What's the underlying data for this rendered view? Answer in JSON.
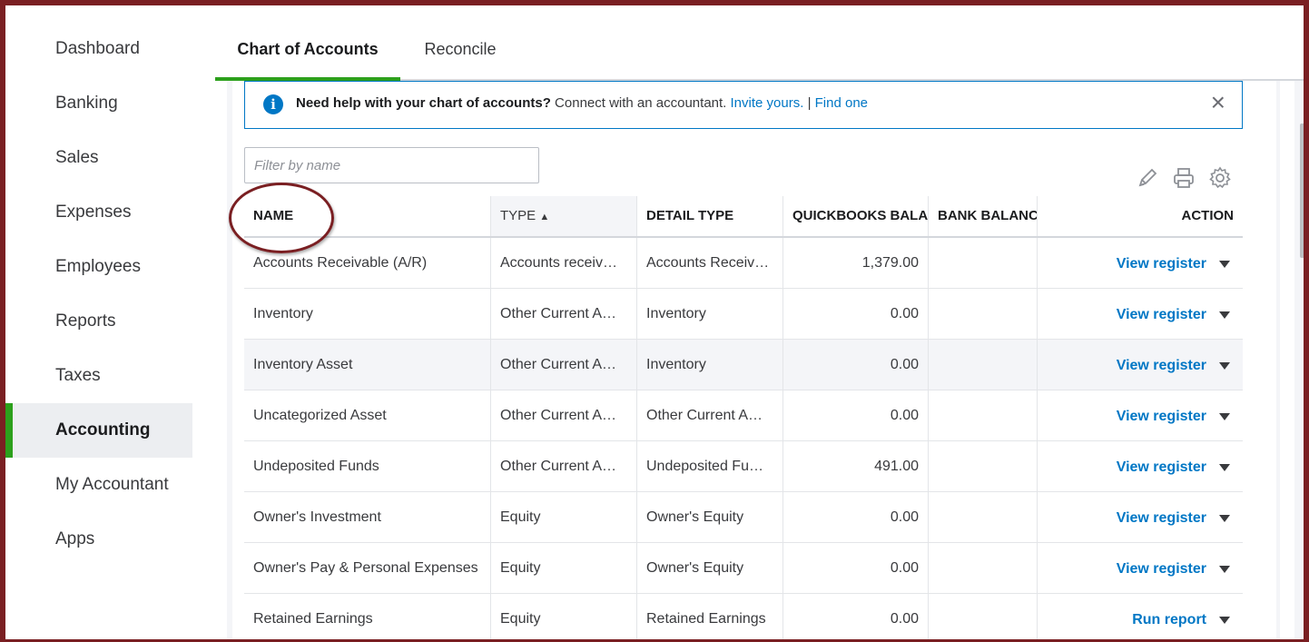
{
  "sidebar": {
    "items": [
      {
        "label": "Dashboard"
      },
      {
        "label": "Banking"
      },
      {
        "label": "Sales"
      },
      {
        "label": "Expenses"
      },
      {
        "label": "Employees"
      },
      {
        "label": "Reports"
      },
      {
        "label": "Taxes"
      },
      {
        "label": "Accounting"
      },
      {
        "label": "My Accountant"
      },
      {
        "label": "Apps"
      }
    ],
    "active": "Accounting"
  },
  "tabs": [
    {
      "label": "Chart of Accounts",
      "active": true
    },
    {
      "label": "Reconcile",
      "active": false
    }
  ],
  "banner": {
    "bold_text": "Need help with your chart of accounts?",
    "text": "Connect with an accountant.",
    "invite_link": "Invite yours.",
    "separator": "|",
    "find_link": "Find one",
    "close_icon": "×",
    "info_icon": "i"
  },
  "filter": {
    "placeholder": "Filter by name",
    "value": ""
  },
  "toolbar": {
    "edit_icon": "pencil-icon",
    "print_icon": "printer-icon",
    "settings_icon": "gear-icon"
  },
  "table": {
    "columns": {
      "name": "NAME",
      "type": "TYPE",
      "detail_type": "DETAIL TYPE",
      "qb_balance": "QUICKBOOKS BALA",
      "bank_balance": "BANK BALANC",
      "action": "ACTION"
    },
    "sort_indicator": "▲",
    "rows": [
      {
        "name": "Accounts Receivable (A/R)",
        "type": "Accounts receiv…",
        "detail": "Accounts Receiv…",
        "qb": "1,379.00",
        "bank": "",
        "action": "View register"
      },
      {
        "name": "Inventory",
        "type": "Other Current A…",
        "detail": "Inventory",
        "qb": "0.00",
        "bank": "",
        "action": "View register"
      },
      {
        "name": "Inventory Asset",
        "type": "Other Current A…",
        "detail": "Inventory",
        "qb": "0.00",
        "bank": "",
        "action": "View register"
      },
      {
        "name": "Uncategorized Asset",
        "type": "Other Current A…",
        "detail": "Other Current A…",
        "qb": "0.00",
        "bank": "",
        "action": "View register"
      },
      {
        "name": "Undeposited Funds",
        "type": "Other Current A…",
        "detail": "Undeposited Fu…",
        "qb": "491.00",
        "bank": "",
        "action": "View register"
      },
      {
        "name": "Owner's Investment",
        "type": "Equity",
        "detail": "Owner's Equity",
        "qb": "0.00",
        "bank": "",
        "action": "View register"
      },
      {
        "name": "Owner's Pay & Personal Expenses",
        "type": "Equity",
        "detail": "Owner's Equity",
        "qb": "0.00",
        "bank": "",
        "action": "View register"
      },
      {
        "name": "Retained Earnings",
        "type": "Equity",
        "detail": "Retained Earnings",
        "qb": "0.00",
        "bank": "",
        "action": "Run report"
      }
    ]
  },
  "colors": {
    "accent": "#2ca01c",
    "link": "#0077c5",
    "frame": "#7a1f22"
  }
}
